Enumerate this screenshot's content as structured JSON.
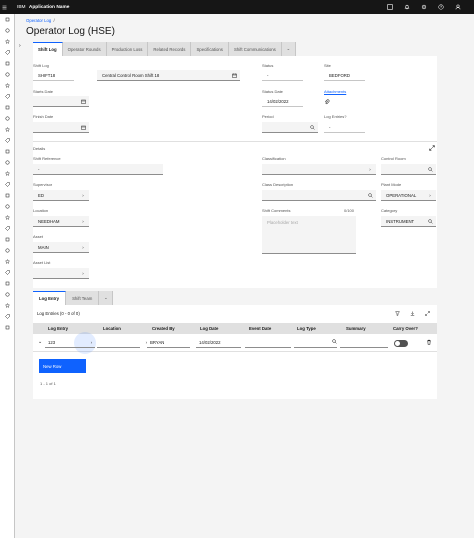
{
  "header": {
    "brand_prefix": "IBM",
    "app_name": "Application Name",
    "actions": [
      "app-switcher-icon",
      "notification-icon",
      "settings-icon",
      "help-icon",
      "user-icon"
    ]
  },
  "sidebar": {
    "items": [
      "home-icon",
      "history-icon",
      "star-icon",
      "tag-icon",
      "rocket-icon",
      "pen-icon",
      "location-icon",
      "cloud-icon",
      "document-icon",
      "list-icon",
      "building-icon",
      "document-icon",
      "task-icon",
      "folder-icon",
      "chart-icon",
      "wrench-icon",
      "grid-icon",
      "gear-icon",
      "tool-icon",
      "launch-icon",
      "data-icon",
      "calendar-icon",
      "inventory-icon",
      "report-icon",
      "user-icon",
      "warning-icon",
      "flag-icon",
      "switch-icon",
      "people-icon"
    ]
  },
  "page": {
    "breadcrumb": "Operator Log",
    "breadcrumb_sep": "/",
    "title": "Operator Log (HSE)"
  },
  "tabs": [
    "Shift Log",
    "Operator Rounds",
    "Production Loss",
    "Related Records",
    "Specifications",
    "Shift Communications"
  ],
  "form": {
    "shift_log": {
      "label": "Shift Log",
      "value": "SHIFT18"
    },
    "shift_desc": {
      "value": "Central Control Room Shift 18"
    },
    "status": {
      "label": "Status",
      "value": "-"
    },
    "site": {
      "label": "Site",
      "value": "BEDFORD"
    },
    "starts_date": {
      "label": "Starts Date",
      "value": ""
    },
    "status_date": {
      "label": "Status Date",
      "value": "14/02/2022"
    },
    "attachments": {
      "label": "Attachments"
    },
    "finish_date": {
      "label": "Finish Date",
      "value": ""
    },
    "period": {
      "label": "Period",
      "value": ""
    },
    "log_entries": {
      "label": "Log Entries?",
      "value": "-"
    },
    "details_heading": "Details",
    "shift_reference": {
      "label": "Shift Reference",
      "value": "-"
    },
    "classification": {
      "label": "Classification",
      "value": ""
    },
    "control_room": {
      "label": "Control Room",
      "value": ""
    },
    "supervisor": {
      "label": "Supervisor",
      "value": "ED"
    },
    "class_desc": {
      "label": "Class Description",
      "value": ""
    },
    "plant_mode": {
      "label": "Plant Mode",
      "value": "OPERATIONAL"
    },
    "location": {
      "label": "Location",
      "value": "NEEDHAM"
    },
    "shift_comments": {
      "label": "Shift Comments",
      "placeholder": "Placeholder text",
      "counter": "0/100"
    },
    "category": {
      "label": "Category",
      "value": "INSTRUMENT"
    },
    "asset": {
      "label": "Asset",
      "value": "MAIN"
    },
    "asset_list": {
      "label": "Asset List",
      "value": ""
    }
  },
  "subtabs": [
    "Log Entry",
    "Shift Team"
  ],
  "log": {
    "title": "Log Entries (0 - 0 of 0)",
    "columns": [
      "Log Entry",
      "Location",
      "Created By",
      "Log Date",
      "Event Date",
      "Log Type",
      "Summary",
      "Carry Over?"
    ],
    "row": {
      "log_entry": "123",
      "location": "",
      "created_by": "BRYAN",
      "log_date": "14/02/2022",
      "event_date": "",
      "log_type": "",
      "summary": ""
    },
    "new_row": "New Row",
    "pager": "1 - 1 of 1"
  }
}
